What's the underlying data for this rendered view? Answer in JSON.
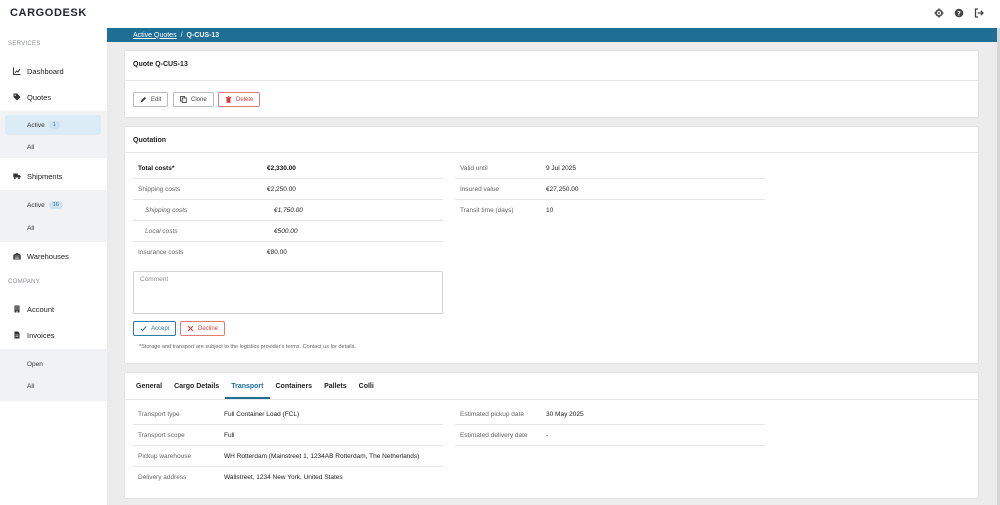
{
  "app": {
    "logo": "CARGODESK"
  },
  "topbar": {
    "icons": [
      "gear-icon",
      "help-icon",
      "logout-icon"
    ]
  },
  "sidebar": {
    "section_services": "SERVICES",
    "section_company": "COMPANY",
    "dashboard": "Dashboard",
    "quotes": "Quotes",
    "quotes_active": "Active",
    "quotes_active_count": "1",
    "quotes_all": "All",
    "shipments": "Shipments",
    "shipments_active": "Active",
    "shipments_active_count": "16",
    "shipments_all": "All",
    "warehouses": "Warehouses",
    "account": "Account",
    "invoices": "Invoices",
    "invoices_open": "Open",
    "invoices_all": "All"
  },
  "breadcrumb": {
    "parent": "Active Quotes",
    "separator": "/",
    "current": "Q-CUS-13"
  },
  "quote_card": {
    "title": "Quote Q-CUS-13",
    "edit_label": "Edit",
    "clone_label": "Clone",
    "delete_label": "Delete"
  },
  "quotation": {
    "title": "Quotation",
    "left_rows": [
      {
        "label": "Total costs*",
        "value": "€2,330.00"
      },
      {
        "label": "Shipping costs",
        "value": "€2,250.00"
      },
      {
        "label": "Shipping costs",
        "value": "€1,750.00"
      },
      {
        "label": "Local costs",
        "value": "€500.00"
      },
      {
        "label": "Insurance costs",
        "value": "€80.00"
      }
    ],
    "right_rows": [
      {
        "label": "Valid until",
        "value": "9 Jul 2025"
      },
      {
        "label": "Insured value",
        "value": "€27,250.00"
      },
      {
        "label": "Transit time (days)",
        "value": "10"
      }
    ],
    "comment_placeholder": "Comment",
    "accept_label": "Accept",
    "decline_label": "Decline",
    "disclaimer": "*Storage and transport are subject to the logistics provider's terms. Contact us for details."
  },
  "details": {
    "tabs": [
      "General",
      "Cargo Details",
      "Transport",
      "Containers",
      "Pallets",
      "Colli"
    ],
    "active_tab": "Transport",
    "left_rows": [
      {
        "label": "Transport type",
        "value": "Full Container Load (FCL)"
      },
      {
        "label": "Transport scope",
        "value": "Full"
      },
      {
        "label": "Pickup warehouse",
        "value": "WH Rotterdam (Mainstreet 1, 1234AB Rotterdam, The Netherlands)"
      },
      {
        "label": "Delivery address",
        "value": "Wallstreet, 1234 New York, United States"
      }
    ],
    "right_rows": [
      {
        "label": "Estimated pickup date",
        "value": "30 May 2025"
      },
      {
        "label": "Estimated delivery date",
        "value": "-"
      }
    ]
  },
  "colors": {
    "brand": "#1e6e96",
    "danger": "#d33f3f",
    "active_bg": "#dcecf6"
  }
}
